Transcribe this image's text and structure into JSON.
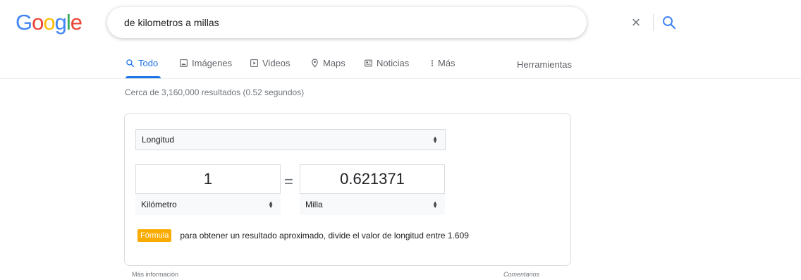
{
  "logo": {
    "letters": [
      "G",
      "o",
      "o",
      "g",
      "l",
      "e"
    ]
  },
  "search": {
    "query": "de kilometros a millas"
  },
  "tabs": [
    {
      "label": "Todo",
      "icon": "search-icon"
    },
    {
      "label": "Imágenes",
      "icon": "image-icon"
    },
    {
      "label": "Videos",
      "icon": "video-icon"
    },
    {
      "label": "Maps",
      "icon": "map-pin-icon"
    },
    {
      "label": "Noticias",
      "icon": "news-icon"
    },
    {
      "label": "Más",
      "icon": "more-vert-icon"
    }
  ],
  "tools_label": "Herramientas",
  "result_stats": "Cerca de 3,160,000 resultados (0.52 segundos)",
  "converter": {
    "category": "Longitud",
    "from_value": "1",
    "from_unit": "Kilómetro",
    "equals": "=",
    "to_value": "0.621371",
    "to_unit": "Milla",
    "formula_badge": "Fórmula",
    "formula_text": "para obtener un resultado aproximado, divide el valor de longitud entre 1.609"
  },
  "more_info": "Más información",
  "feedback": "Comentarios",
  "colors": {
    "accent": "#1a73e8",
    "formula_badge": "#f9ab00"
  }
}
